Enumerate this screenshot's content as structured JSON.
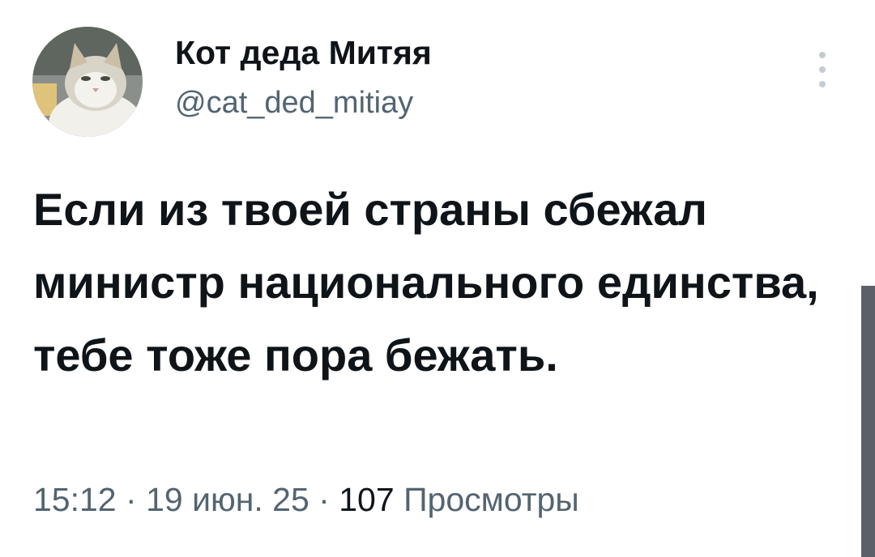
{
  "author": {
    "display_name": "Кот деда Митяя",
    "handle": "@cat_ded_mitiay"
  },
  "tweet": {
    "text": "Если из твоей страны сбежал министр национального единства, тебе тоже пора бежать."
  },
  "meta": {
    "time": "15:12",
    "separator": "·",
    "date": "19 июн. 25",
    "views_count": "107",
    "views_label": "Просмотры"
  },
  "icons": {
    "more": "more-vertical-icon",
    "avatar": "cat-avatar"
  },
  "colors": {
    "text_primary": "#0f1419",
    "text_secondary": "#536471",
    "background": "#ffffff"
  }
}
